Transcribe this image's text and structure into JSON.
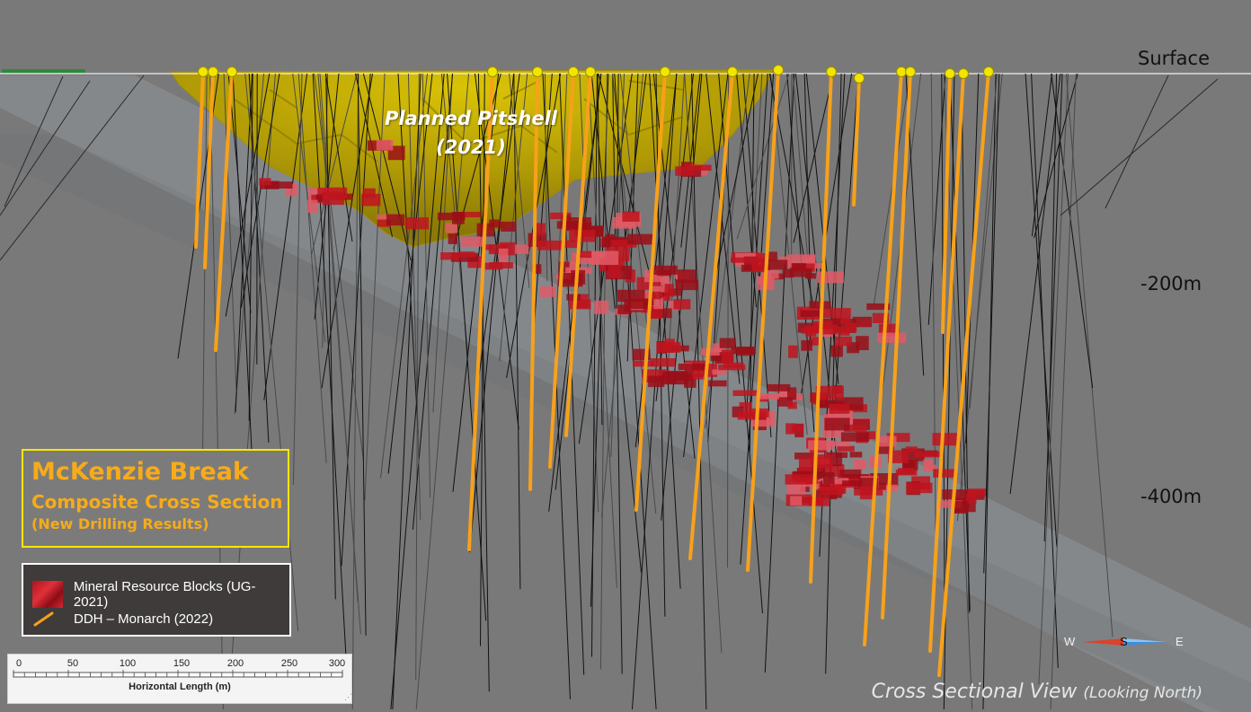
{
  "labels": {
    "surface": "Surface",
    "depth_200": "-200m",
    "depth_400": "-400m",
    "pitshell_line1": "Planned Pitshell",
    "pitshell_line2": "(2021)"
  },
  "title_box": {
    "title": "McKenzie Break",
    "subtitle": "Composite Cross Section",
    "note": "(New Drilling Results)"
  },
  "legend": {
    "items": [
      {
        "label": "Mineral Resource Blocks (UG-2021)",
        "icon": "resource-blocks-swatch"
      },
      {
        "label": "DDH – Monarch (2022)",
        "icon": "orange-drillhole-line"
      }
    ]
  },
  "scale_bar": {
    "ticks": [
      "0",
      "50",
      "100",
      "150",
      "200",
      "250",
      "300"
    ],
    "title": "Horizontal Length (m)"
  },
  "compass": {
    "west": "W",
    "south": "S",
    "east": "E"
  },
  "view": {
    "main": "Cross Sectional View",
    "sub": "(Looking North)"
  },
  "colors": {
    "background": "#797979",
    "pitshell": "#c9b200",
    "resource_blocks": "#c0141e",
    "ddh_monarch": "#f7a11a",
    "historic_drillholes": "#111111",
    "title_border": "#ffe600",
    "title_text": "#f7ab1a"
  }
}
